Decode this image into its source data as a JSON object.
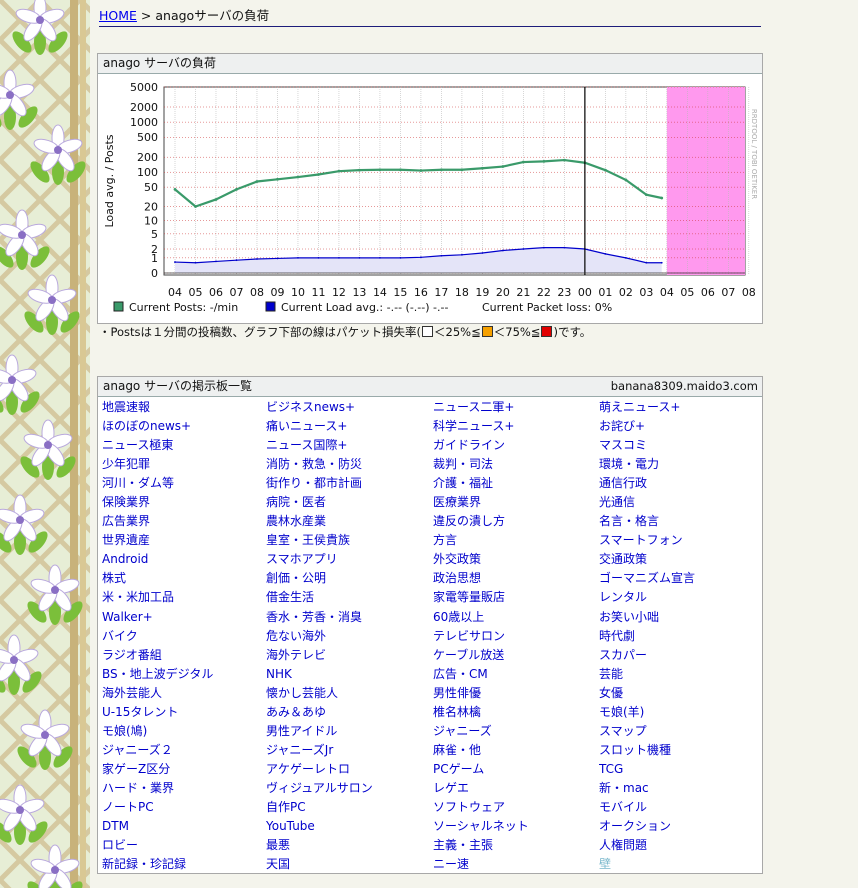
{
  "breadcrumb": {
    "home": "HOME",
    "sep": ">",
    "current": "anagoサーバの負荷"
  },
  "load_panel": {
    "title": "anago サーバの負荷",
    "watermark": "RRDTOOL / TOBI OETIKER",
    "legend": {
      "posts": "Current Posts: -/min",
      "load": "Current Load avg.: -.-- (-.--) -.--",
      "loss": "Current Packet loss: 0%"
    }
  },
  "note": {
    "prefix": "・Postsは１分間の投稿数、グラフ下部の線はパケット損失率(",
    "p1": "＜25%≦",
    "p2": "＜75%≦",
    "suffix": ")です。"
  },
  "boards_panel": {
    "title": "anago サーバの掲示板一覧",
    "host": "banana8309.maido3.com",
    "items": [
      "地震速報",
      "ビジネスnews+",
      "ニュース二軍+",
      "萌えニュース+",
      "ほのぼのnews+",
      "痛いニュース+",
      "科学ニュース+",
      "お詫び+",
      "ニュース極東",
      "ニュース国際+",
      "ガイドライン",
      "マスコミ",
      "少年犯罪",
      "消防・救急・防災",
      "裁判・司法",
      "環境・電力",
      "河川・ダム等",
      "街作り・都市計画",
      "介護・福祉",
      "通信行政",
      "保険業界",
      "病院・医者",
      "医療業界",
      "光通信",
      "広告業界",
      "農林水産業",
      "違反の潰し方",
      "名言・格言",
      "世界遺産",
      "皇室・王侯貴族",
      "方言",
      "スマートフォン",
      "Android",
      "スマホアプリ",
      "外交政策",
      "交通政策",
      "株式",
      "創価・公明",
      "政治思想",
      "ゴーマニズム宣言",
      "米・米加工品",
      "借金生活",
      "家電等量販店",
      "レンタル",
      "Walker+",
      "香水・芳香・消臭",
      "60歳以上",
      "お笑い小咄",
      "バイク",
      "危ない海外",
      "テレビサロン",
      "時代劇",
      "ラジオ番組",
      "海外テレビ",
      "ケーブル放送",
      "スカパー",
      "BS・地上波デジタル",
      "NHK",
      "広告・CM",
      "芸能",
      "海外芸能人",
      "懐かし芸能人",
      "男性俳優",
      "女優",
      "U-15タレント",
      "あみ＆あゆ",
      "椎名林檎",
      "モ娘(羊)",
      "モ娘(鳩)",
      "男性アイドル",
      "ジャニーズ",
      "スマップ",
      "ジャニーズ２",
      "ジャニーズJr",
      "麻雀・他",
      "スロット機種",
      "家ゲーZ区分",
      "アケゲーレトロ",
      "PCゲーム",
      "TCG",
      "ハード・業界",
      "ヴィジュアルサロン",
      "レゲエ",
      "新・mac",
      "ノートPC",
      "自作PC",
      "ソフトウェア",
      "モバイル",
      "DTM",
      "YouTube",
      "ソーシャルネット",
      "オークション",
      "ロビー",
      "最悪",
      "主義・主張",
      "人権問題",
      "新記録・珍記録",
      "天国",
      "ニー速",
      "壁"
    ]
  },
  "chart_data": {
    "type": "line",
    "ylabel": "Load avg. / Posts",
    "y_ticks": [
      "5000",
      "2000",
      "1000",
      "500",
      "200",
      "100",
      "50",
      "20",
      "10",
      "5",
      "2",
      "1",
      "0"
    ],
    "x_ticks": [
      "04",
      "05",
      "06",
      "07",
      "08",
      "09",
      "10",
      "11",
      "12",
      "13",
      "14",
      "15",
      "16",
      "17",
      "18",
      "19",
      "20",
      "21",
      "22",
      "23",
      "00",
      "01",
      "02",
      "03",
      "04",
      "05",
      "06",
      "07",
      "08"
    ],
    "series": [
      {
        "name": "Current Posts",
        "color": "#3a9a6a",
        "x": [
          "04:00",
          "05:00",
          "06:00",
          "07:00",
          "08:00",
          "09:00",
          "10:00",
          "11:00",
          "12:00",
          "13:00",
          "14:00",
          "15:00",
          "16:00",
          "17:00",
          "18:00",
          "19:00",
          "20:00",
          "21:00",
          "22:00",
          "23:00",
          "00:00",
          "01:00",
          "02:00",
          "03:00",
          "03:45"
        ],
        "values": [
          45,
          20,
          28,
          45,
          65,
          72,
          80,
          90,
          105,
          110,
          112,
          112,
          108,
          112,
          112,
          120,
          130,
          160,
          165,
          175,
          155,
          110,
          70,
          35,
          30
        ]
      },
      {
        "name": "Current Load avg.",
        "color": "#0000cc",
        "x": [
          "04:00",
          "05:00",
          "06:00",
          "07:00",
          "08:00",
          "09:00",
          "10:00",
          "11:00",
          "12:00",
          "13:00",
          "14:00",
          "15:00",
          "16:00",
          "17:00",
          "18:00",
          "19:00",
          "20:00",
          "21:00",
          "22:00",
          "23:00",
          "00:00",
          "01:00",
          "02:00",
          "03:00",
          "03:45"
        ],
        "values": [
          0.65,
          0.6,
          0.7,
          0.8,
          0.9,
          0.95,
          1.0,
          1.0,
          1.0,
          1.0,
          1.0,
          1.0,
          1.05,
          1.2,
          1.3,
          1.5,
          1.8,
          2.0,
          2.2,
          2.2,
          2.0,
          1.4,
          1.0,
          0.6,
          0.6
        ]
      }
    ],
    "now": "00:00",
    "future_from": "04:00",
    "colors": {
      "posts_fill": "#3a9a6a",
      "load_fill": "#e4e4f8",
      "load_line": "#0000cc",
      "future": "#ff99ee"
    }
  },
  "colors": {
    "link": "#0000cc",
    "loss_low": "#ffffff",
    "loss_mid": "#f5a000",
    "loss_high": "#e00000"
  }
}
